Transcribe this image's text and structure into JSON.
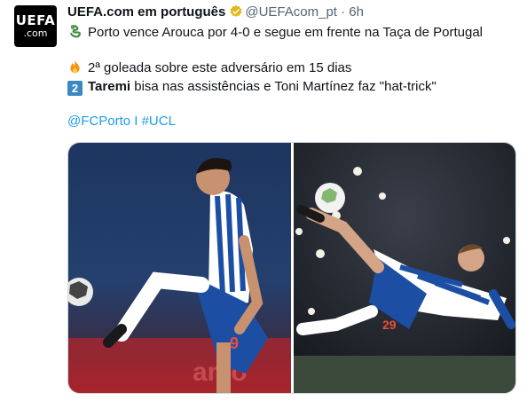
{
  "account": {
    "avatar_line1": "UEFA",
    "avatar_line2": ".com",
    "name": "UEFA.com em português",
    "handle": "@UEFAcom_pt",
    "separator": "·",
    "time": "6h"
  },
  "tweet": {
    "line1": "Porto vence Arouca por 4-0 e segue em frente na Taça de Portugal",
    "line2": "2ª goleada sobre este adversário em 15 dias",
    "line3_number": "2",
    "line3_bold": "Taremi",
    "line3_rest": " bisa nas assistências e Toni Martínez faz \"hat-trick\"",
    "hashtag_user": "@FCPorto",
    "hashtag_divider": " I ",
    "hashtag": "#UCL",
    "line1_icon": "dragon-icon",
    "line2_icon": "fire-icon"
  },
  "colors": {
    "link": "#1d9bf0",
    "verified_badge": "#e2b719",
    "porto_blue": "#1c4fa3"
  },
  "media": {
    "photo1_overlay_text": "amo",
    "photo2_shirt_number": "29",
    "photo1_shirt_number": "9"
  }
}
